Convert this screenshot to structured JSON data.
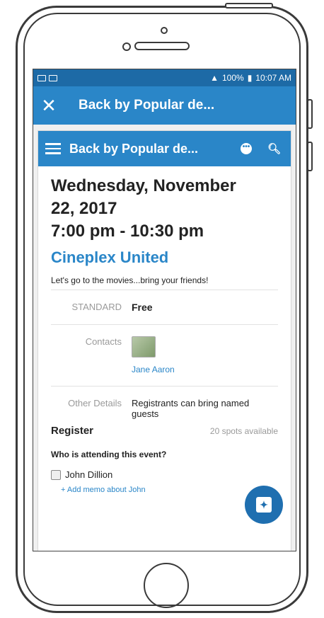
{
  "status_bar": {
    "battery": "100%",
    "time": "10:07 AM"
  },
  "app_bar": {
    "title": "Back by Popular de..."
  },
  "inner_bar": {
    "title": "Back by Popular de..."
  },
  "event": {
    "date_line1": "Wednesday, November",
    "date_line2": "22, 2017",
    "time": "7:00 pm - 10:30 pm",
    "venue": "Cineplex United",
    "description": "Let's go to the movies...bring your friends!"
  },
  "details": {
    "ticket_label": "STANDARD",
    "ticket_price": "Free",
    "contacts_label": "Contacts",
    "contact_name": "Jane Aaron",
    "other_label": "Other Details",
    "other_value": "Registrants can bring named guests"
  },
  "register": {
    "title": "Register",
    "spots": "20 spots available",
    "question": "Who is attending this event?",
    "attendee": "John Dillion",
    "add_memo": "+ Add memo about John"
  },
  "colors": {
    "primary": "#2a86c8",
    "status_bar": "#1d6aa6",
    "fab": "#1f6fb0"
  },
  "icons": [
    "close-icon",
    "menu-icon",
    "more-icon",
    "search-icon",
    "chat-add-icon"
  ]
}
